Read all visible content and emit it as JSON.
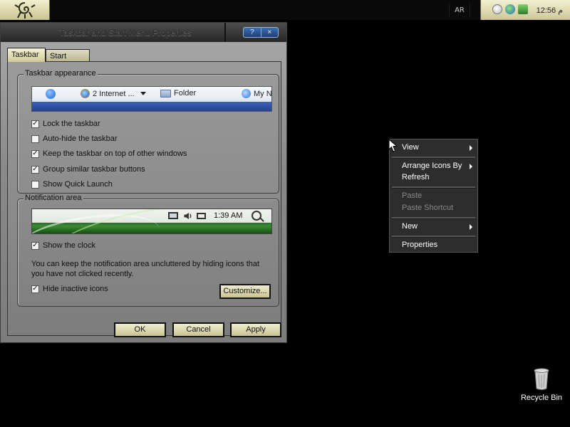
{
  "taskbar": {
    "language": "AR",
    "clock": "12:56 م"
  },
  "dialog": {
    "title": "Taskbar and Start Menu Properties",
    "help_label": "?",
    "close_label": "×",
    "tabs": [
      {
        "label": "Taskbar",
        "active": true
      },
      {
        "label": "Start Menu",
        "active": false
      }
    ],
    "appearance": {
      "group_label": "Taskbar appearance",
      "preview_items": [
        "2 Internet ...",
        "Folder",
        "My N"
      ],
      "options": [
        {
          "label": "Lock the taskbar",
          "checked": true
        },
        {
          "label": "Auto-hide the taskbar",
          "checked": false
        },
        {
          "label": "Keep the taskbar on top of other windows",
          "checked": true
        },
        {
          "label": "Group similar taskbar buttons",
          "checked": true
        },
        {
          "label": "Show Quick Launch",
          "checked": false
        }
      ]
    },
    "notification": {
      "group_label": "Notification area",
      "preview_time": "1:39 AM",
      "show_clock": {
        "label": "Show the clock",
        "checked": true
      },
      "note": "You can keep the notification area uncluttered by hiding icons that you have not clicked recently.",
      "hide_inactive": {
        "label": "Hide inactive icons",
        "checked": true
      },
      "customize_label": "Customize..."
    },
    "buttons": {
      "ok": "OK",
      "cancel": "Cancel",
      "apply": "Apply"
    }
  },
  "context_menu": {
    "items": [
      {
        "label": "View",
        "submenu": true,
        "disabled": false
      },
      {
        "label": "Arrange Icons By",
        "submenu": true,
        "disabled": false
      },
      {
        "label": "Refresh",
        "submenu": false,
        "disabled": false
      },
      {
        "label": "Paste",
        "submenu": false,
        "disabled": true
      },
      {
        "label": "Paste Shortcut",
        "submenu": false,
        "disabled": true
      },
      {
        "label": "New",
        "submenu": true,
        "disabled": false
      },
      {
        "label": "Properties",
        "submenu": false,
        "disabled": false
      }
    ]
  },
  "desktop": {
    "icons": [
      {
        "label": "Recycle Bin",
        "icon": "recycle-bin-icon"
      }
    ]
  },
  "colors": {
    "accent_gold": "#cfc99a",
    "menu_bg": "#2d2d2d",
    "desktop_bg": "#000000"
  }
}
